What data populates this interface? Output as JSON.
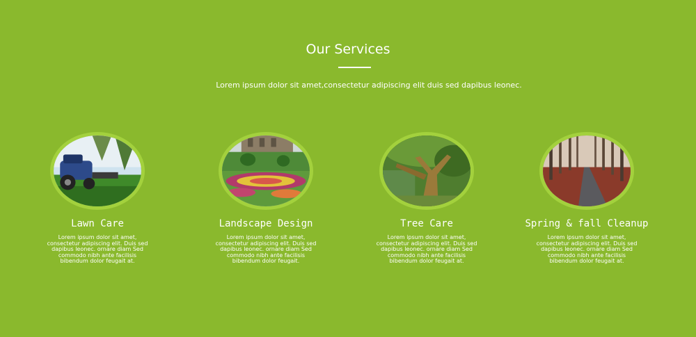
{
  "section": {
    "title": "Our Services",
    "subtitle": "Lorem ipsum dolor sit amet,consectetur adipiscing elit duis sed dapibus leonec."
  },
  "services": [
    {
      "title": "Lawn Care",
      "image_icon": "lawn-mower-photo",
      "text": "Lorem ipsum dolor sit amet, consectetur adipiscing elit. Duis sed dapibus leonec. ornare diam Sed commodo nibh ante facilisis bibendum dolor feugait at."
    },
    {
      "title": "Landscape Design",
      "image_icon": "garden-flowerbed-photo",
      "text": "Lorem ipsum dolor sit amet, consectetur adipiscing elit. Duis sed dapibus leonec. ornare diam Sed commodo nibh ante facilisis bibendum dolor feugait."
    },
    {
      "title": "Tree Care",
      "image_icon": "tree-photo",
      "text": "Lorem ipsum dolor sit amet, consectetur adipiscing elit. Duis sed dapibus leonec. ornare diam Sed commodo nibh ante facilisis bibendum dolor feugait at."
    },
    {
      "title": "Spring & fall Cleanup",
      "image_icon": "autumn-road-photo",
      "text": "Lorem ipsum dolor sit amet, consectetur adipiscing elit. Duis sed dapibus leonec. ornare diam Sed commodo nibh ante facilisis bibendum dolor feugait at."
    }
  ],
  "colors": {
    "background": "#8ab92d",
    "circle_border": "#a3d13d",
    "text": "#ffffff"
  }
}
